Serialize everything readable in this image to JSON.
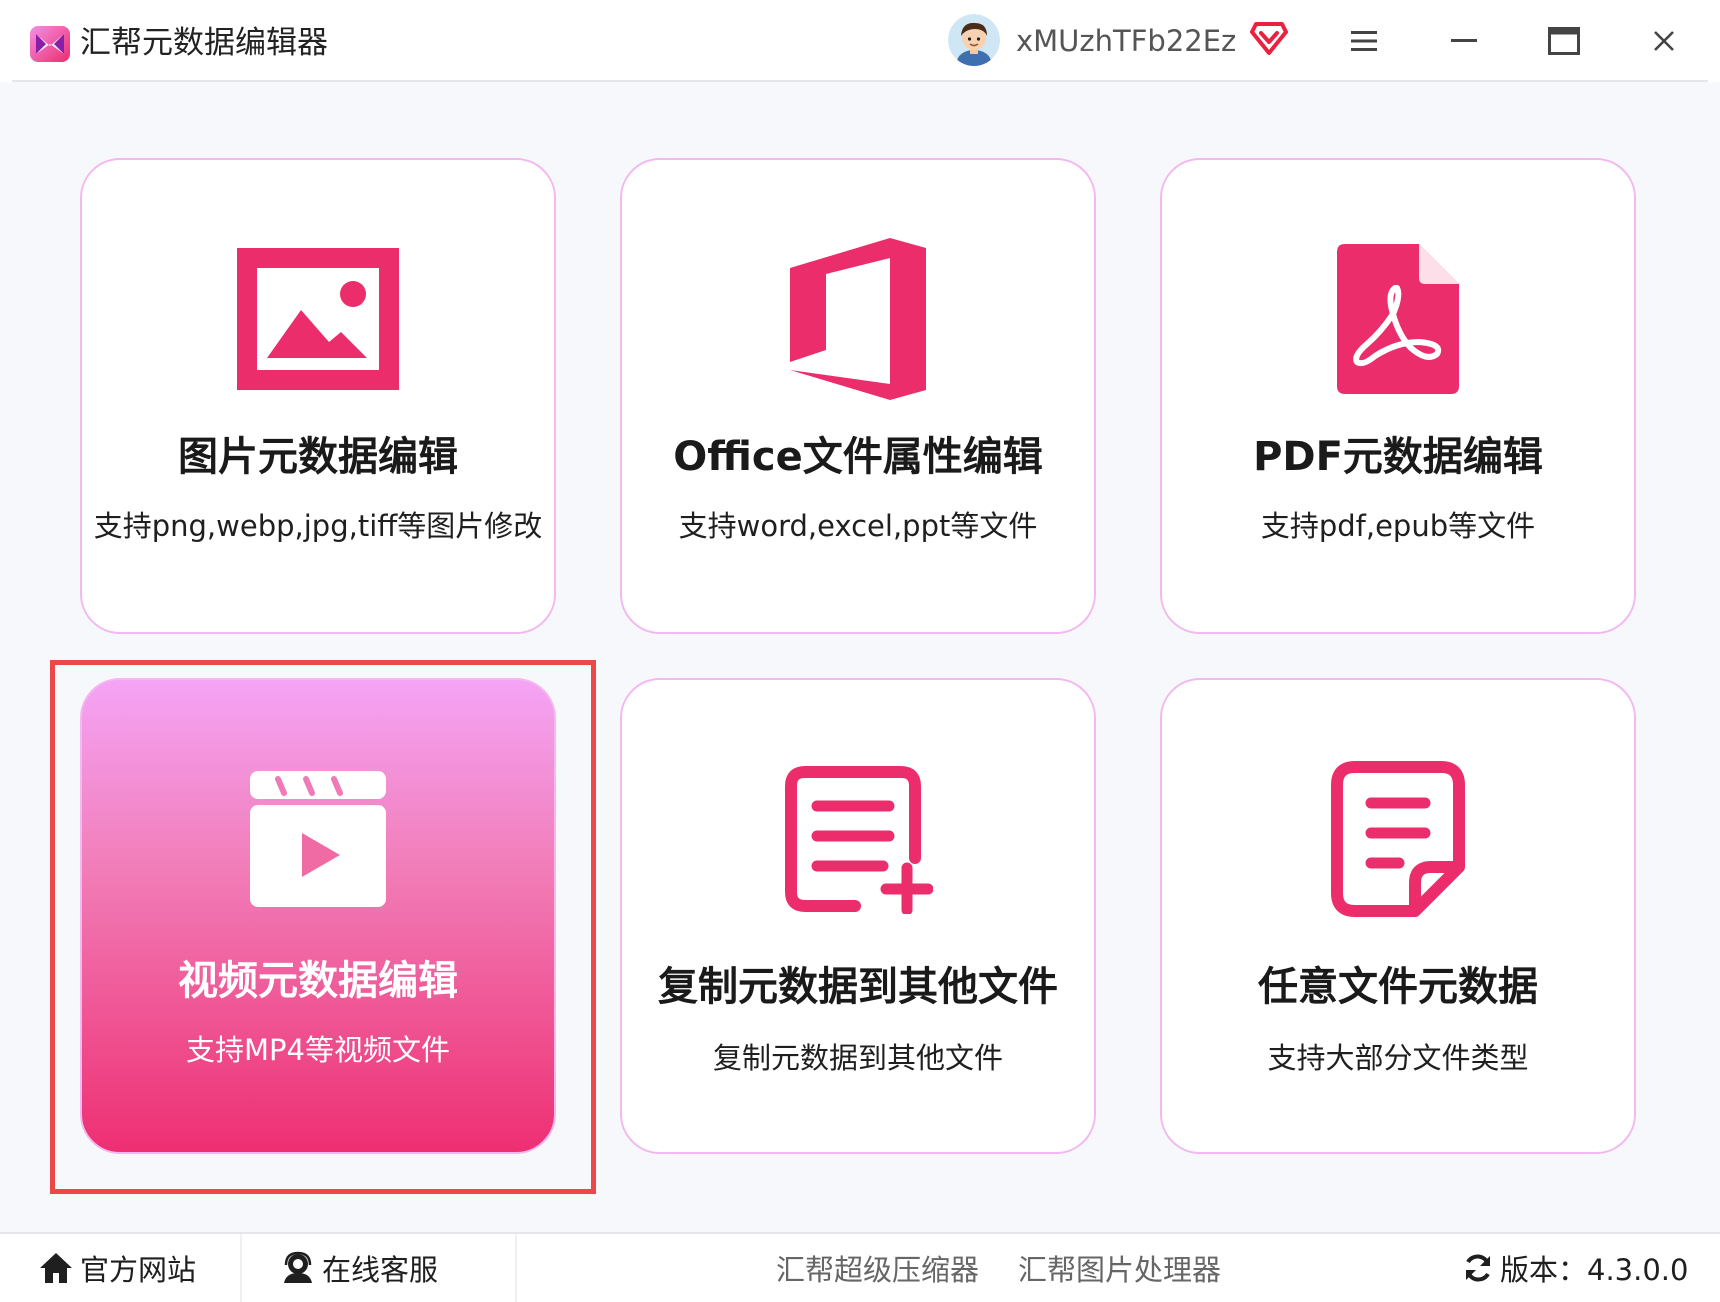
{
  "app": {
    "title": "汇帮元数据编辑器",
    "username": "xMUzhTFb22Ez"
  },
  "cards": [
    {
      "title": "图片元数据编辑",
      "desc": "支持png,webp,jpg,tiff等图片修改",
      "icon": "image-icon"
    },
    {
      "title": "Office文件属性编辑",
      "desc": "支持word,excel,ppt等文件",
      "icon": "office-icon"
    },
    {
      "title": "PDF元数据编辑",
      "desc": "支持pdf,epub等文件",
      "icon": "pdf-icon"
    },
    {
      "title": "视频元数据编辑",
      "desc": "支持MP4等视频文件",
      "icon": "video-clapper-icon",
      "active": true
    },
    {
      "title": "复制元数据到其他文件",
      "desc": "复制元数据到其他文件",
      "icon": "document-add-icon"
    },
    {
      "title": "任意文件元数据",
      "desc": "支持大部分文件类型",
      "icon": "document-lines-icon"
    }
  ],
  "footer": {
    "home": "官方网站",
    "service": "在线客服",
    "compress": "汇帮超级压缩器",
    "image_tool": "汇帮图片处理器",
    "version": "版本：4.3.0.0"
  },
  "colors": {
    "accent": "#ec2d6c",
    "card_border": "#f3b8ef",
    "highlight": "#ec4848",
    "active_gradient_top": "#f5a4f6",
    "active_gradient_bottom": "#ee2f72"
  }
}
